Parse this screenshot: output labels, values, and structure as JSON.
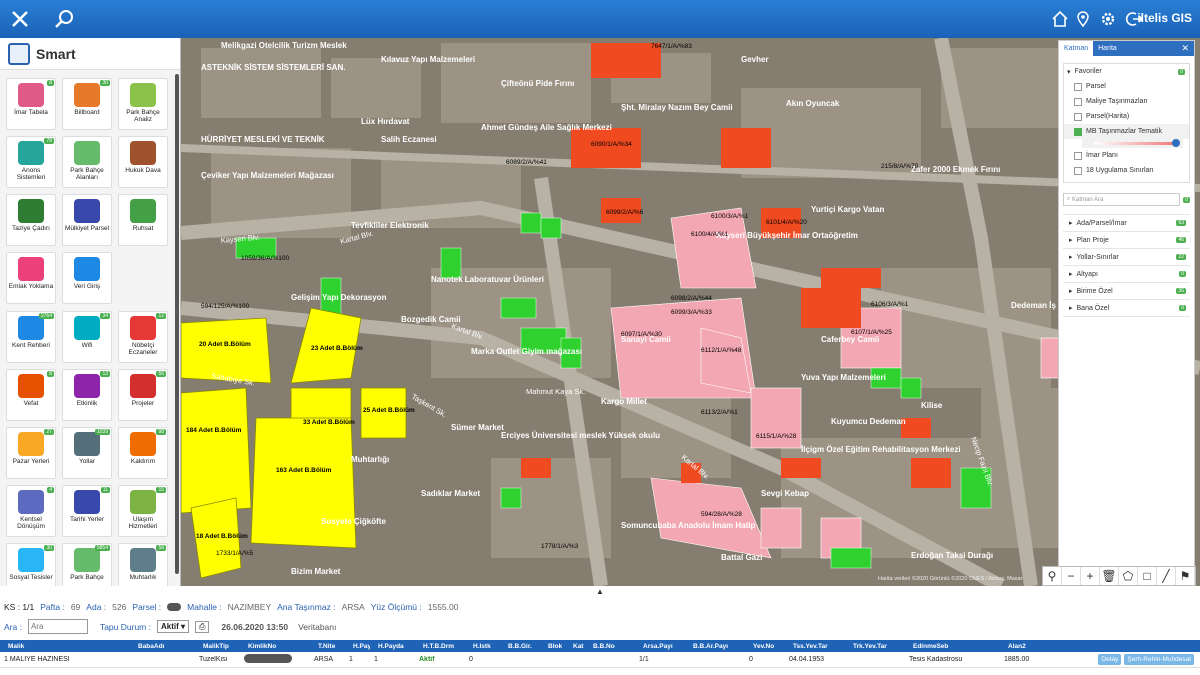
{
  "topbar": {
    "brand": "iltelis GIS"
  },
  "side": {
    "title": "Smart",
    "tiles_a": [
      {
        "label": "İmar Tabela",
        "badge": "8",
        "color": "#e05a88"
      },
      {
        "label": "Billboard",
        "badge": "30",
        "color": "#e67a2a"
      },
      {
        "label": "Park Bahçe Analiz",
        "badge": "",
        "color": "#8bc34a"
      },
      {
        "label": "Anons Sistemleri",
        "badge": "78",
        "color": "#26a69a"
      },
      {
        "label": "Park Bahçe Alanları",
        "badge": "",
        "color": "#66bb6a"
      },
      {
        "label": "Hukuk Dava",
        "badge": "",
        "color": "#a0522d"
      },
      {
        "label": "Taziye Çadırı",
        "badge": "",
        "color": "#2e7d32"
      },
      {
        "label": "Mülkiyet Parsel",
        "badge": "",
        "color": "#3949ab"
      },
      {
        "label": "Ruhsat",
        "badge": "",
        "color": "#43a047"
      },
      {
        "label": "Emlak Yoklama",
        "badge": "",
        "color": "#ec407a"
      },
      {
        "label": "Veri Giriş",
        "badge": "",
        "color": "#1e88e5"
      }
    ],
    "tiles_b": [
      {
        "label": "Kent Rehberi",
        "badge": "2764",
        "color": "#1e88e5"
      },
      {
        "label": "Wifi",
        "badge": "34",
        "color": "#00acc1"
      },
      {
        "label": "Nöbetçi Eczaneler",
        "badge": "12",
        "color": "#e53935"
      },
      {
        "label": "Vefat",
        "badge": "8",
        "color": "#e65100"
      },
      {
        "label": "Etkinlik",
        "badge": "13",
        "color": "#8e24aa"
      },
      {
        "label": "Projeler",
        "badge": "56",
        "color": "#d32f2f"
      },
      {
        "label": "Pazar Yerleri",
        "badge": "27",
        "color": "#f9a825"
      },
      {
        "label": "Yollar",
        "badge": "1039",
        "color": "#546e7a"
      },
      {
        "label": "Kaldırım",
        "badge": "98",
        "color": "#ef6c00"
      },
      {
        "label": "Kentsel Dönüşüm",
        "badge": "4",
        "color": "#5c6bc0"
      },
      {
        "label": "Tarihi Yerler",
        "badge": "11",
        "color": "#3949ab"
      },
      {
        "label": "Ulaşım Hizmetleri",
        "badge": "15",
        "color": "#7cb342"
      },
      {
        "label": "Sosyal Tesisler",
        "badge": "30",
        "color": "#29b6f6"
      },
      {
        "label": "Park Bahçe",
        "badge": "5854",
        "color": "#66bb6a"
      },
      {
        "label": "Muhtarlık",
        "badge": "58",
        "color": "#607d8b"
      }
    ]
  },
  "map": {
    "streets": [
      "Kartal Blv.",
      "Kartal Blv.",
      "Kartal Blv.",
      "Necip Fazıl Blv.",
      "Sahabiye Sk.",
      "Mahmut Kaya Sk.",
      "Taşkent Sk.",
      "Kayseri Blv."
    ],
    "pois": [
      "Melikgazi Otelcilik Turizm Meslek",
      "ASTEKNİK SİSTEM SİSTEMLERİ SAN.",
      "Kılavuz Yapı Malzemeleri",
      "Çifteönü Pide Fırını",
      "Ahmet Gündeş Aile Sağlık Merkezi",
      "Şht. Miralay Nazım Bey Camii",
      "Gevher",
      "Akın Oyuncak",
      "Lüx Hırdavat",
      "HÜRRİYET MESLEKİ VE TEKNİK",
      "Salih Eczanesi",
      "Yurtiçi Kargo Vatan",
      "Zafer 2000 Ekmek Fırını",
      "Çeviker Yapı Malzemeleri Mağazası",
      "Tevfikliler Elektronik",
      "Kayseri Büyükşehir İmar Ortaöğretim",
      "Nanotek Laboratuvar Ürünleri",
      "Gelişim Yapı Dekorasyon",
      "Bozgedik Camii",
      "Sanayi Camii",
      "Caferbey Camii",
      "Marka Outlet Giyim mağazası",
      "Yuva Yapı Malzemeleri",
      "Kargo Millet",
      "Kuyumcu Dedeman",
      "Kilise",
      "Dedeman İş Merkezi",
      "Erciyes Üniversitesi meslek Yüksek okulu",
      "Sümer Market",
      "Sadıklar Market",
      "İlçigm Özel Eğitim Rehabilitasyon Merkezi",
      "Sosyete Çiğköfte",
      "Somuncubaba Anadolu İmam Hatip",
      "Erdoğan Taksi Durağı",
      "Bizim Market",
      "Battal Gazi",
      "Muhtarlığı",
      "Sevgi Kebap"
    ],
    "parcels": [
      "6090/1/A/%34",
      "6089/2/A/%41",
      "6099/2/A/%6",
      "6100/3/A/%1",
      "6100/4/A/%1",
      "6101/4/A/%20",
      "6097/1/A/%30",
      "6098/2/A/%44",
      "6099/3/A/%33",
      "6112/1/A/%48",
      "6113/2/A/%1",
      "6115/1/A/%28",
      "6107/1/A/%25",
      "6106/3/A/%1",
      "594/28/A/%28",
      "1778/1/A/%3",
      "1733/1/A/%5",
      "7647/1/A/%83",
      "215/8/A/%70",
      "1059/36/A/%100",
      "594/125/A/%100"
    ],
    "yellow": [
      "20 Adet B.Bölüm",
      "23 Adet B.Bölüm",
      "33 Adet B.Bölüm",
      "184 Adet B.Bölüm",
      "163 Adet B.Bölüm",
      "25 Adet B.Bölüm",
      "18 Adet B.Bölüm"
    ],
    "attribution": "Harita verileri ©2020 Görüntü ©2020 CNES / Airbus, Maxar"
  },
  "layers": {
    "tabs": [
      "Katman",
      "Harita"
    ],
    "favorites": "Favoriler",
    "fav_badge": "0",
    "items": [
      "Parsel",
      "Maliye Taşınmazları",
      "Parsel(Harita)",
      "MB Taşınmazlar Tematik",
      "İmar Planı",
      "18 Uygulama Sınırları"
    ],
    "search_placeholder": "Katman Ara",
    "groups": [
      {
        "label": "Ada/Parsel/İmar",
        "badge": "63"
      },
      {
        "label": "Plan Proje",
        "badge": "46"
      },
      {
        "label": "Yollar-Sınırlar",
        "badge": "22"
      },
      {
        "label": "Altyapı",
        "badge": "0"
      },
      {
        "label": "Birime Özel",
        "badge": "36"
      },
      {
        "label": "Bana Özel",
        "badge": "0"
      }
    ]
  },
  "info": {
    "ks": "KS : 1/1",
    "pafta_l": "Pafta :",
    "pafta_v": "69",
    "ada_l": "Ada :",
    "ada_v": "526",
    "parsel_l": "Parsel :",
    "mahalle_l": "Mahalle :",
    "mahalle_v": "NAZIMBEY",
    "tasinmaz_l": "Ana Taşınmaz :",
    "tasinmaz_v": "ARSA",
    "yuz_l": "Yüz Ölçümü :",
    "yuz_v": "1555.00",
    "ara_l": "Ara :",
    "ara_ph": "Ara",
    "tapu_l": "Tapu Durum :",
    "tapu_v": "Aktif",
    "datetime": "26.06.2020 13:50",
    "db": "Veritabanı"
  },
  "table": {
    "headers": [
      "Malik",
      "BabaAdı",
      "MalikTip",
      "KimlikNo",
      "T.Nite",
      "H.Pay",
      "H.Payda",
      "H.T.B.Drm",
      "H.Istk",
      "B.B.Gir.",
      "Blok",
      "Kat",
      "B.B.No",
      "Arsa.Payı",
      "B.B.Ar.Payı",
      "Yev.No",
      "Tss.Yev.Tar",
      "Trk.Yev.Tar",
      "EdinmeSeb",
      "Alan2"
    ],
    "row": [
      "1 MALİYE HAZİNESİ",
      "",
      "TuzelKisi",
      "",
      "ARSA",
      "1",
      "1",
      "Aktif",
      "0",
      "",
      "",
      "",
      "",
      "1/1",
      "",
      "0",
      "04.04.1953",
      "",
      "Tesis Kadastrosu",
      "1885.00"
    ],
    "btn1": "Detay",
    "btn2": "Şerh-Rehin-Muhdesat"
  }
}
